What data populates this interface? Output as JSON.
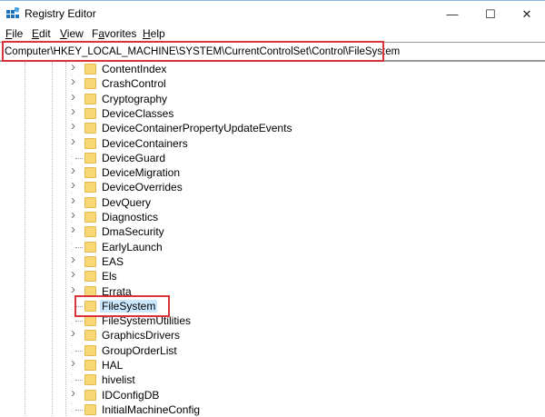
{
  "window": {
    "title": "Registry Editor",
    "minimize": "—",
    "maximize": "☐",
    "close": "✕"
  },
  "menu": [
    {
      "key": "F",
      "rest": "ile"
    },
    {
      "key": "E",
      "rest": "dit"
    },
    {
      "key": "V",
      "rest": "iew"
    },
    {
      "pre": "F",
      "key": "a",
      "rest": "vorites"
    },
    {
      "key": "H",
      "rest": "elp"
    }
  ],
  "address": "Computer\\HKEY_LOCAL_MACHINE\\SYSTEM\\CurrentControlSet\\Control\\FileSystem",
  "tree": [
    {
      "label": "ContentIndex",
      "expandable": true
    },
    {
      "label": "CrashControl",
      "expandable": true
    },
    {
      "label": "Cryptography",
      "expandable": true
    },
    {
      "label": "DeviceClasses",
      "expandable": true
    },
    {
      "label": "DeviceContainerPropertyUpdateEvents",
      "expandable": true
    },
    {
      "label": "DeviceContainers",
      "expandable": true
    },
    {
      "label": "DeviceGuard",
      "expandable": false
    },
    {
      "label": "DeviceMigration",
      "expandable": true
    },
    {
      "label": "DeviceOverrides",
      "expandable": true
    },
    {
      "label": "DevQuery",
      "expandable": true
    },
    {
      "label": "Diagnostics",
      "expandable": true
    },
    {
      "label": "DmaSecurity",
      "expandable": true
    },
    {
      "label": "EarlyLaunch",
      "expandable": false
    },
    {
      "label": "EAS",
      "expandable": true
    },
    {
      "label": "Els",
      "expandable": true
    },
    {
      "label": "Errata",
      "expandable": true
    },
    {
      "label": "FileSystem",
      "expandable": false,
      "selected": true
    },
    {
      "label": "FileSystemUtilities",
      "expandable": false
    },
    {
      "label": "GraphicsDrivers",
      "expandable": true
    },
    {
      "label": "GroupOrderList",
      "expandable": false
    },
    {
      "label": "HAL",
      "expandable": true
    },
    {
      "label": "hivelist",
      "expandable": false
    },
    {
      "label": "IDConfigDB",
      "expandable": true
    },
    {
      "label": "InitialMachineConfig",
      "expandable": false
    }
  ],
  "colors": {
    "highlight": "#d9343a",
    "selection": "#cce8ff",
    "folder": "#f8d775"
  }
}
